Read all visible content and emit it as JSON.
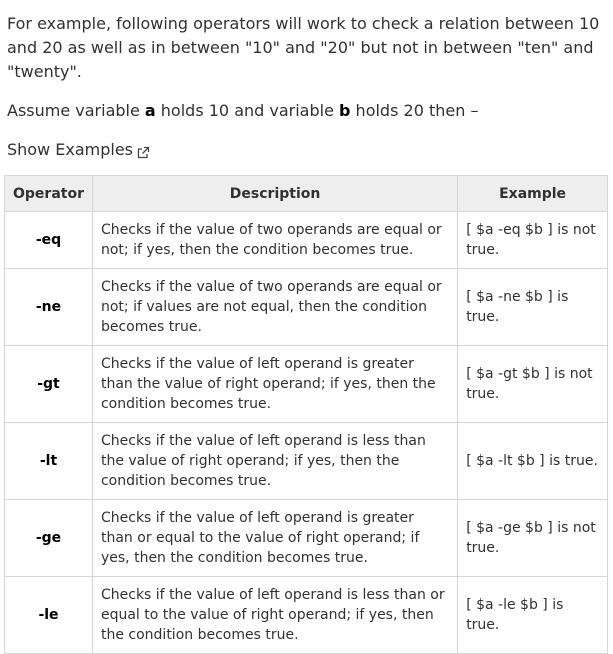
{
  "intro_text": "For example, following operators will work to check a relation between 10 and 20 as well as in between \"10\" and \"20\" but not in between \"ten\" and \"twenty\".",
  "assume": {
    "prefix": "Assume variable ",
    "var_a": "a",
    "middle": " holds 10 and variable ",
    "var_b": "b",
    "suffix": " holds 20 then –"
  },
  "show_examples_label": "Show Examples",
  "table": {
    "headers": [
      "Operator",
      "Description",
      "Example"
    ],
    "rows": [
      {
        "operator": "-eq",
        "description": "Checks if the value of two operands are equal or not; if yes, then the condition becomes true.",
        "example": "[ $a -eq $b ] is not true."
      },
      {
        "operator": "-ne",
        "description": "Checks if the value of two operands are equal or not; if values are not equal, then the condition becomes true.",
        "example": "[ $a -ne $b ] is true."
      },
      {
        "operator": "-gt",
        "description": "Checks if the value of left operand is greater than the value of right operand; if yes, then the condition becomes true.",
        "example": "[ $a -gt $b ] is not true."
      },
      {
        "operator": "-lt",
        "description": "Checks if the value of left operand is less than the value of right operand; if yes, then the condition becomes true.",
        "example": "[ $a -lt $b ] is true."
      },
      {
        "operator": "-ge",
        "description": "Checks if the value of left operand is greater than or equal to the value of right operand; if yes, then the condition becomes true.",
        "example": "[ $a -ge $b ] is not true."
      },
      {
        "operator": "-le",
        "description": "Checks if the value of left operand is less than or equal to the value of right operand; if yes, then the condition becomes true.",
        "example": "[ $a -le $b ] is true."
      }
    ]
  },
  "icons": {
    "show_examples": "external-link-icon"
  }
}
